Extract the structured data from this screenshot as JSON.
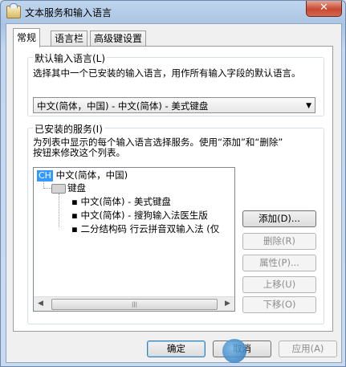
{
  "window": {
    "title": "文本服务和输入语言",
    "close_glyph": "✕"
  },
  "tabs": [
    {
      "label": "常规",
      "active": true
    },
    {
      "label": "语言栏",
      "active": false
    },
    {
      "label": "高级键设置",
      "active": false
    }
  ],
  "default_language": {
    "group_label": "默认输入语言(L)",
    "description": "选择其中一个已安装的输入语言，用作所有输入字段的默认语言。",
    "selected": "中文(简体，中国) - 中文(简体) - 美式键盘"
  },
  "installed_services": {
    "group_label": "已安装的服务(I)",
    "description_line1": "为列表中显示的每个输入语言选择服务。使用“添加”和“删除”",
    "description_line2": "按钮来修改这个列表。",
    "tree": {
      "language_badge": "CH",
      "language": "中文(简体，中国)",
      "category": "键盘",
      "items": [
        "中文(简体) - 美式键盘",
        "中文(简体) - 搜狗输入法医生版",
        "二分结构码 行云拼音双输入法 (仅"
      ]
    },
    "scrollbar": {
      "left_glyph": "◀",
      "right_glyph": "▶",
      "thumb_grip": "|||"
    }
  },
  "side_buttons": [
    {
      "label": "添加(D)...",
      "enabled": true
    },
    {
      "label": "删除(R)",
      "enabled": false
    },
    {
      "label": "属性(P)...",
      "enabled": false
    },
    {
      "label": "上移(U)",
      "enabled": false
    },
    {
      "label": "下移(O)",
      "enabled": false
    }
  ],
  "footer": {
    "ok_label": "确定",
    "cancel_label": "取消",
    "apply_label": "应用(A)"
  },
  "colors": {
    "title_bar": "#bfd5ee",
    "close_button": "#c74a32",
    "selection_badge": "#3399ff"
  }
}
